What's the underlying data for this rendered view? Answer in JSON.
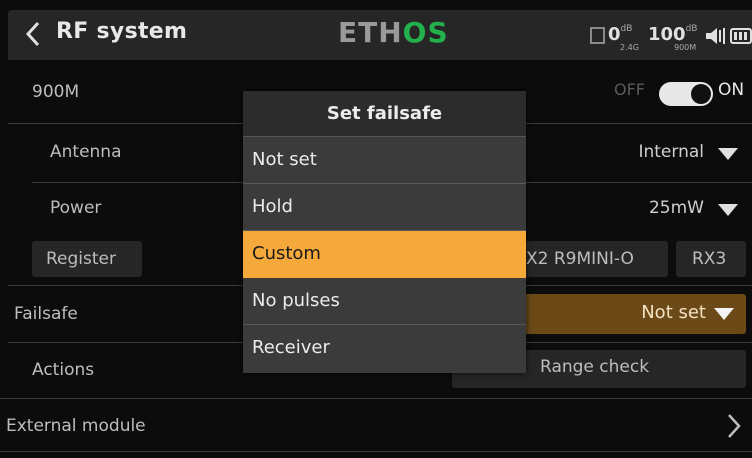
{
  "header": {
    "title": "RF system",
    "logo_main": "ETH",
    "logo_accent": "OS",
    "rssi_2g4_value": "0",
    "rssi_2g4_unit": "dB",
    "rssi_2g4_band": "2.4G",
    "rssi_900_value": "100",
    "rssi_900_unit": "dB",
    "rssi_900_band": "900M",
    "accent_color": "#22b14c"
  },
  "module_900": {
    "label": "900M",
    "toggle_off_label": "OFF",
    "toggle_on_label": "ON",
    "enabled": true
  },
  "antenna": {
    "label": "Antenna",
    "value": "Internal"
  },
  "power": {
    "label": "Power",
    "value": "25mW"
  },
  "register": {
    "button_label": "Register",
    "slot_2_partial": "X2 R9MINI-O",
    "slot_3": "RX3"
  },
  "failsafe": {
    "label": "Failsafe",
    "value": "Not set"
  },
  "actions": {
    "label": "Actions",
    "range_check_label": "Range check"
  },
  "external_module": {
    "label": "External module"
  },
  "dialog": {
    "title": "Set failsafe",
    "options": [
      "Not set",
      "Hold",
      "Custom",
      "No pulses",
      "Receiver"
    ],
    "selected": "Custom",
    "highlight_color": "#f5a93b"
  }
}
